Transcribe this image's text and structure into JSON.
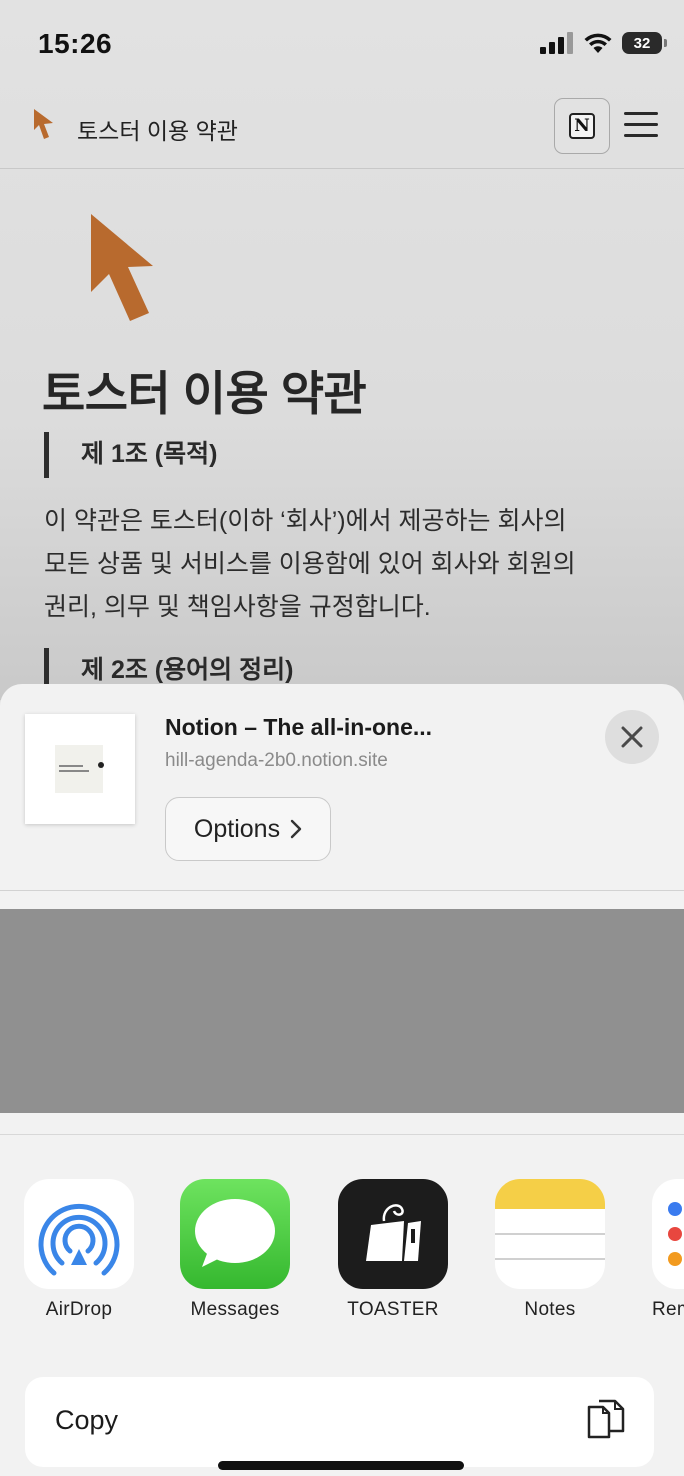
{
  "status_bar": {
    "time": "15:26",
    "battery": "32"
  },
  "site_header": {
    "title": "토스터 이용 약관",
    "notion_button_glyph": "N"
  },
  "article": {
    "title": "토스터 이용 약관",
    "section_1_heading": "제 1조 (목적)",
    "section_1_lines": [
      "이 약관은 토스터(이하 ‘회사’)에서 제공하는 회사의",
      "모든 상품 및 서비스를 이용함에 있어 회사와 회원의",
      "권리, 의무 및 책임사항을 규정합니다."
    ],
    "section_2_heading": "제 2조 (용어의 정리)"
  },
  "share_sheet": {
    "title": "Notion – The all-in-one...",
    "url": "hill-agenda-2b0.notion.site",
    "options_label": "Options",
    "apps": [
      {
        "label": "AirDrop",
        "icon": "airdrop-icon"
      },
      {
        "label": "Messages",
        "icon": "messages-icon"
      },
      {
        "label": "TOASTER",
        "icon": "toaster-app-icon"
      },
      {
        "label": "Notes",
        "icon": "notes-icon"
      },
      {
        "label": "Rem",
        "icon": "reminders-icon"
      }
    ],
    "copy_label": "Copy"
  },
  "colors": {
    "brand_cursor": "#b86a2e",
    "sheet_background": "#f2f2f2",
    "preview_gray": "#909090",
    "airdrop_blue": "#3a86e8"
  }
}
